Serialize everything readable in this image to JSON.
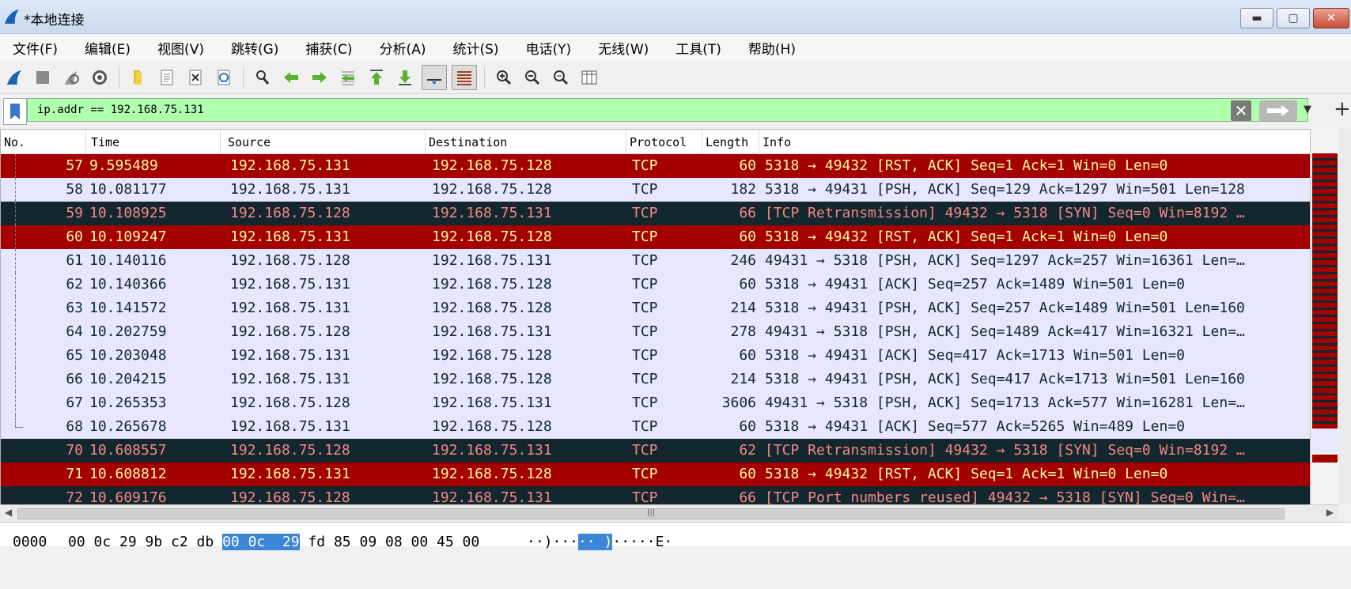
{
  "window": {
    "title": "*本地连接",
    "minimize": "▬",
    "maximize": "▢",
    "close": "✕"
  },
  "menu": [
    "文件(F)",
    "编辑(E)",
    "视图(V)",
    "跳转(G)",
    "捕获(C)",
    "分析(A)",
    "统计(S)",
    "电话(Y)",
    "无线(W)",
    "工具(T)",
    "帮助(H)"
  ],
  "toolbar": {
    "icons": [
      "shark-fin-icon",
      "stop-square-icon",
      "restart-icon",
      "options-gear-icon",
      "open-folder-icon",
      "save-file-icon",
      "close-file-icon",
      "reload-icon",
      "find-packet-icon",
      "back-arrow-icon",
      "forward-arrow-icon",
      "go-to-packet-icon",
      "first-packet-icon",
      "last-packet-icon",
      "autoscroll-icon",
      "colorize-icon",
      "zoom-in-icon",
      "zoom-out-icon",
      "normal-size-icon",
      "resize-columns-icon"
    ]
  },
  "filter": {
    "value": "ip.addr == 192.168.75.131",
    "clear": "✕",
    "dropdown": "▼",
    "add": "+"
  },
  "columns": [
    "No.",
    "Time",
    "Source",
    "Destination",
    "Protocol",
    "Length",
    "Info"
  ],
  "packets": [
    {
      "no": "57",
      "time": "9.595489",
      "src": "192.168.75.131",
      "dst": "192.168.75.128",
      "proto": "TCP",
      "len": "60",
      "info": "5318 → 49432 [RST, ACK] Seq=1 Ack=1 Win=0 Len=0",
      "style": "red"
    },
    {
      "no": "58",
      "time": "10.081177",
      "src": "192.168.75.131",
      "dst": "192.168.75.128",
      "proto": "TCP",
      "len": "182",
      "info": "5318 → 49431 [PSH, ACK] Seq=129 Ack=1297 Win=501 Len=128",
      "style": "normal"
    },
    {
      "no": "59",
      "time": "10.108925",
      "src": "192.168.75.128",
      "dst": "192.168.75.131",
      "proto": "TCP",
      "len": "66",
      "info": "[TCP Retransmission] 49432 → 5318 [SYN] Seq=0 Win=8192 …",
      "style": "dark"
    },
    {
      "no": "60",
      "time": "10.109247",
      "src": "192.168.75.131",
      "dst": "192.168.75.128",
      "proto": "TCP",
      "len": "60",
      "info": "5318 → 49432 [RST, ACK] Seq=1 Ack=1 Win=0 Len=0",
      "style": "red"
    },
    {
      "no": "61",
      "time": "10.140116",
      "src": "192.168.75.128",
      "dst": "192.168.75.131",
      "proto": "TCP",
      "len": "246",
      "info": "49431 → 5318 [PSH, ACK] Seq=1297 Ack=257 Win=16361 Len=…",
      "style": "normal"
    },
    {
      "no": "62",
      "time": "10.140366",
      "src": "192.168.75.131",
      "dst": "192.168.75.128",
      "proto": "TCP",
      "len": "60",
      "info": "5318 → 49431 [ACK] Seq=257 Ack=1489 Win=501 Len=0",
      "style": "normal"
    },
    {
      "no": "63",
      "time": "10.141572",
      "src": "192.168.75.131",
      "dst": "192.168.75.128",
      "proto": "TCP",
      "len": "214",
      "info": "5318 → 49431 [PSH, ACK] Seq=257 Ack=1489 Win=501 Len=160",
      "style": "normal"
    },
    {
      "no": "64",
      "time": "10.202759",
      "src": "192.168.75.128",
      "dst": "192.168.75.131",
      "proto": "TCP",
      "len": "278",
      "info": "49431 → 5318 [PSH, ACK] Seq=1489 Ack=417 Win=16321 Len=…",
      "style": "normal"
    },
    {
      "no": "65",
      "time": "10.203048",
      "src": "192.168.75.131",
      "dst": "192.168.75.128",
      "proto": "TCP",
      "len": "60",
      "info": "5318 → 49431 [ACK] Seq=417 Ack=1713 Win=501 Len=0",
      "style": "normal"
    },
    {
      "no": "66",
      "time": "10.204215",
      "src": "192.168.75.131",
      "dst": "192.168.75.128",
      "proto": "TCP",
      "len": "214",
      "info": "5318 → 49431 [PSH, ACK] Seq=417 Ack=1713 Win=501 Len=160",
      "style": "normal"
    },
    {
      "no": "67",
      "time": "10.265353",
      "src": "192.168.75.128",
      "dst": "192.168.75.131",
      "proto": "TCP",
      "len": "3606",
      "info": "49431 → 5318 [PSH, ACK] Seq=1713 Ack=577 Win=16281 Len=…",
      "style": "normal"
    },
    {
      "no": "68",
      "time": "10.265678",
      "src": "192.168.75.131",
      "dst": "192.168.75.128",
      "proto": "TCP",
      "len": "60",
      "info": "5318 → 49431 [ACK] Seq=577 Ack=5265 Win=489 Len=0",
      "style": "normal"
    },
    {
      "no": "70",
      "time": "10.608557",
      "src": "192.168.75.128",
      "dst": "192.168.75.131",
      "proto": "TCP",
      "len": "62",
      "info": "[TCP Retransmission] 49432 → 5318 [SYN] Seq=0 Win=8192 …",
      "style": "dark"
    },
    {
      "no": "71",
      "time": "10.608812",
      "src": "192.168.75.131",
      "dst": "192.168.75.128",
      "proto": "TCP",
      "len": "60",
      "info": "5318 → 49432 [RST, ACK] Seq=1 Ack=1 Win=0 Len=0",
      "style": "red"
    },
    {
      "no": "72",
      "time": "10.609176",
      "src": "192.168.75.128",
      "dst": "192.168.75.131",
      "proto": "TCP",
      "len": "66",
      "info": "[TCP Port numbers reused] 49432 → 5318 [SYN] Seq=0 Win=…",
      "style": "dark"
    }
  ],
  "row_colors": {
    "red_bg": "#a40000",
    "red_fg": "#fffc9c",
    "dark_bg": "#12272e",
    "dark_fg": "#f78787",
    "normal_bg": "#e7e6ff",
    "filter_bg": "#afffaf"
  },
  "hex": {
    "offset": "0000",
    "bytes_before": "00 0c 29 9b c2 db ",
    "bytes_highlight": "00 0c  29",
    "bytes_after": " fd 85 09 08 00 45 00",
    "ascii_before": "··)···",
    "ascii_highlight": "·· )",
    "ascii_after": "·····E·"
  }
}
